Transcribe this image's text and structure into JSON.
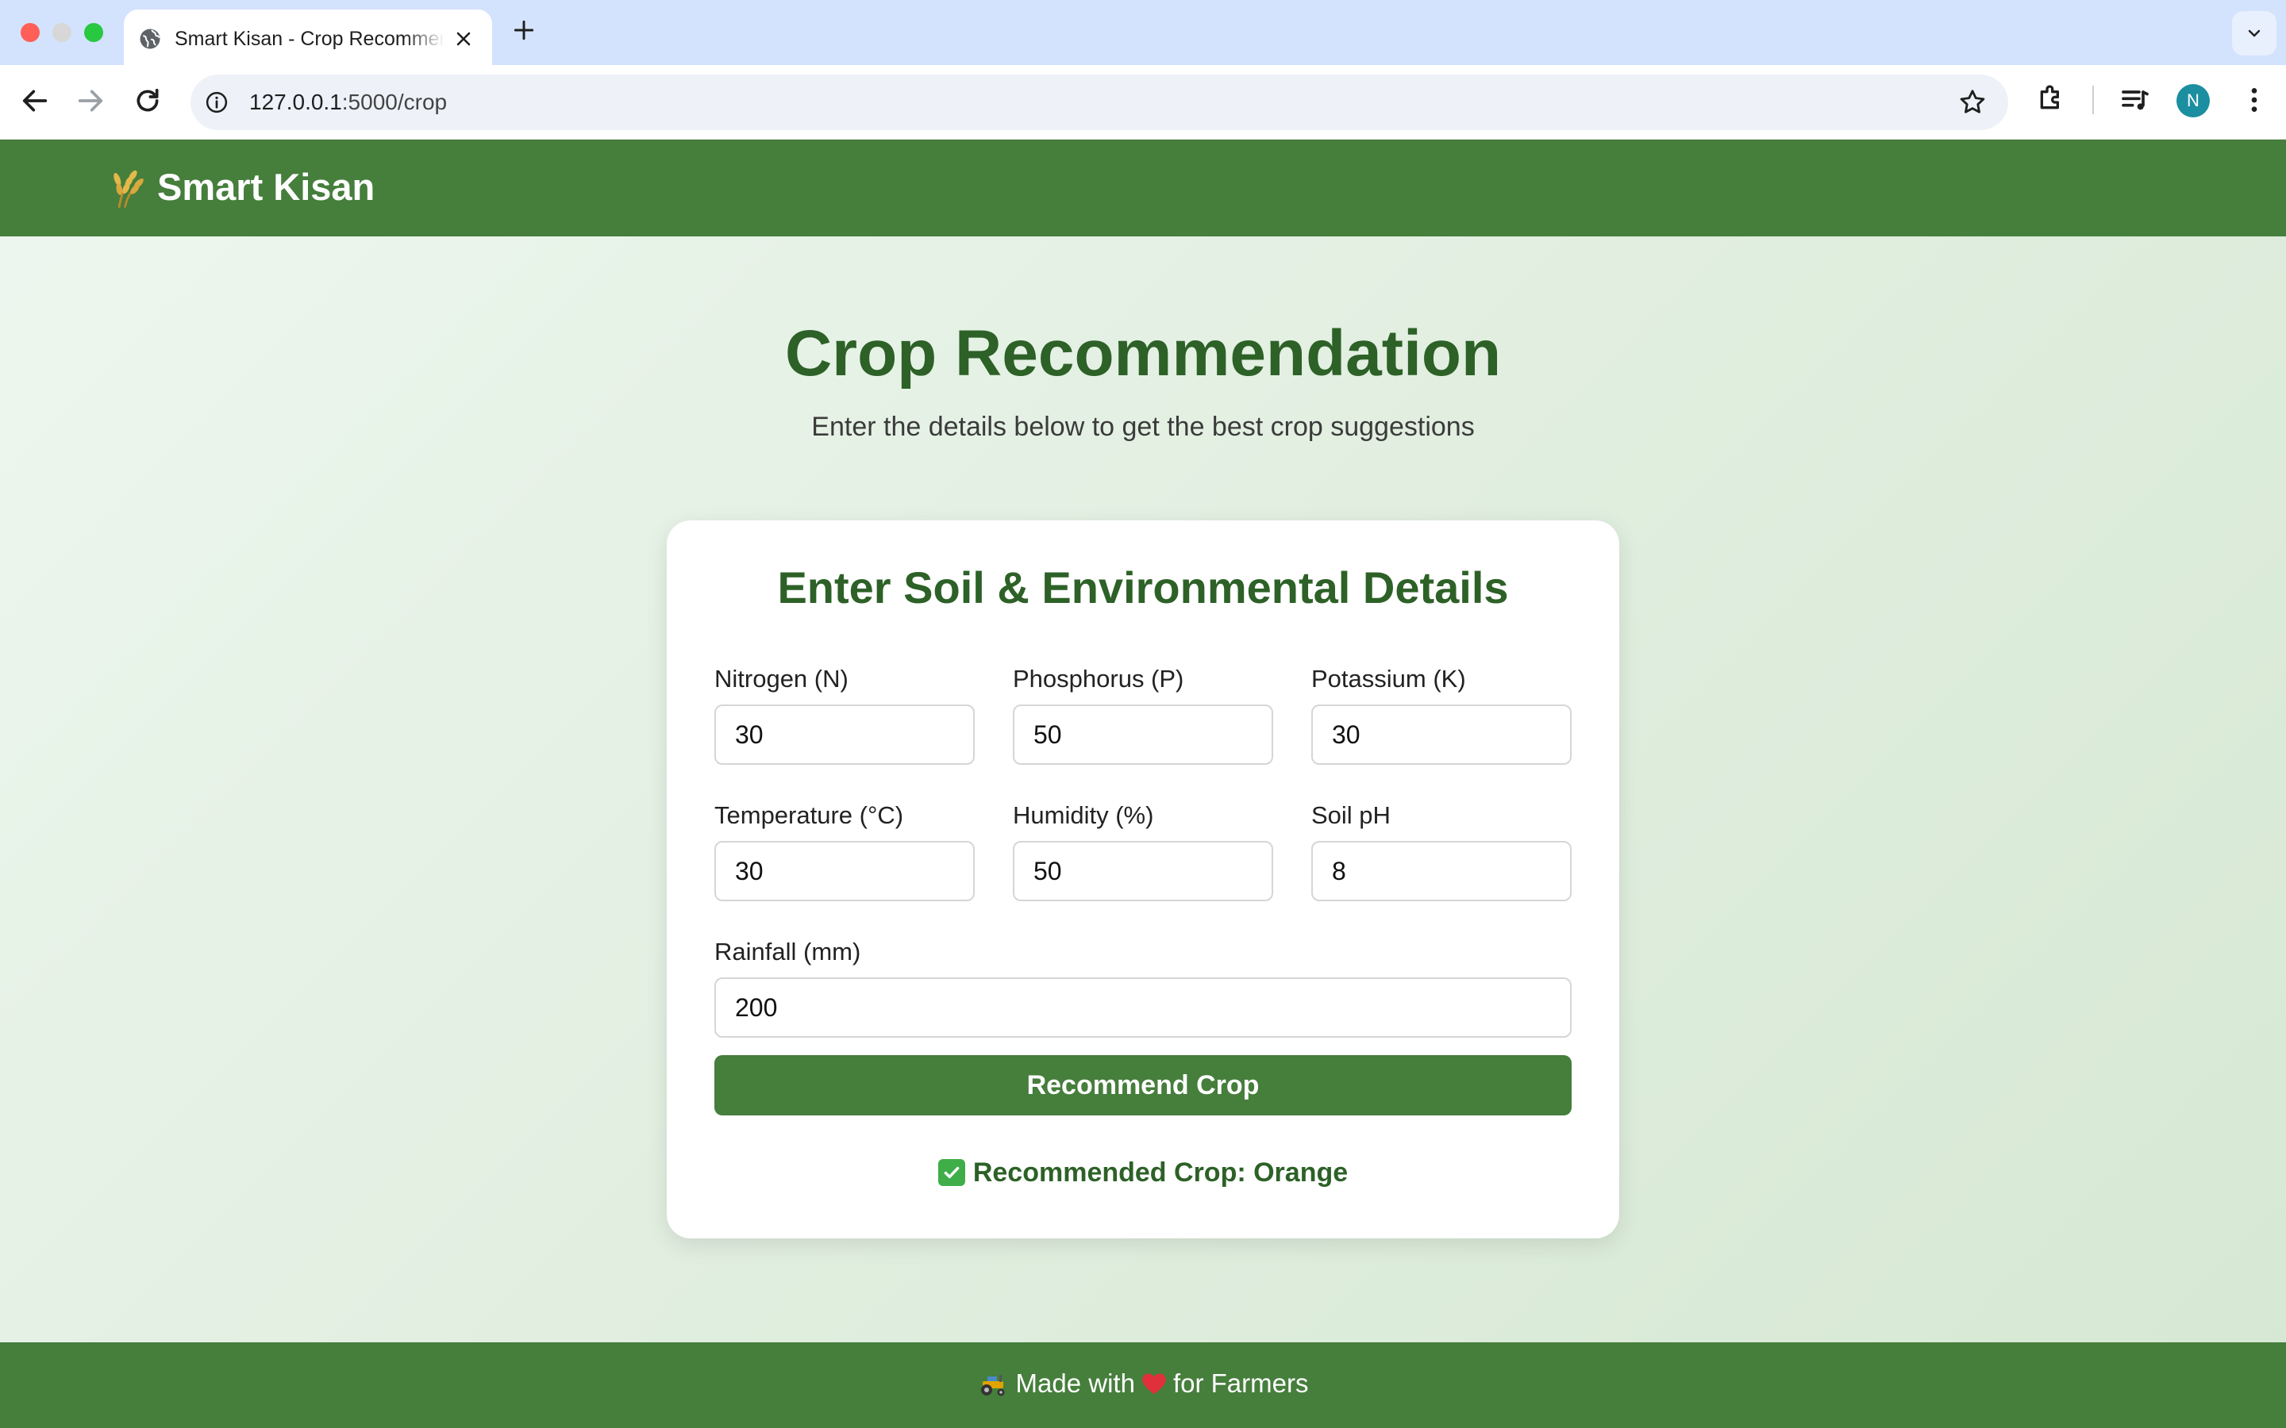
{
  "browser": {
    "tab_title": "Smart Kisan - Crop Recommendation",
    "url_host": "127.0.0.1",
    "url_rest": ":5000/crop",
    "profile_initial": "N"
  },
  "site": {
    "brand": "Smart Kisan",
    "brand_icon": "rice-stalk-icon"
  },
  "hero": {
    "title": "Crop Recommendation",
    "subtitle": "Enter the details below to get the best crop suggestions"
  },
  "form": {
    "title": "Enter Soil & Environmental Details",
    "fields": {
      "nitrogen": {
        "label": "Nitrogen (N)",
        "value": "30"
      },
      "phosphorus": {
        "label": "Phosphorus (P)",
        "value": "50"
      },
      "potassium": {
        "label": "Potassium (K)",
        "value": "30"
      },
      "temperature": {
        "label": "Temperature (°C)",
        "value": "30"
      },
      "humidity": {
        "label": "Humidity (%)",
        "value": "50"
      },
      "ph": {
        "label": "Soil pH",
        "value": "8"
      },
      "rainfall": {
        "label": "Rainfall (mm)",
        "value": "200"
      }
    },
    "submit_label": "Recommend Crop",
    "result_text": "Recommended Crop: Orange"
  },
  "footer": {
    "before": "Made with",
    "after": "for Farmers"
  },
  "colors": {
    "brand_green": "#467e3c",
    "heading_green": "#2d6127",
    "check_green": "#3fae49"
  }
}
